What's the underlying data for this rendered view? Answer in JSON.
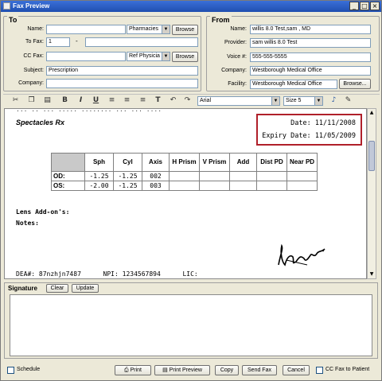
{
  "window": {
    "title": "Fax Preview",
    "minimize": "_",
    "maximize": "□",
    "close": "×"
  },
  "to": {
    "group_title": "To",
    "name_label": "Name:",
    "name_value": "",
    "name_type": "Pharmacies",
    "browse": "Browse",
    "tofax_label": "To Fax:",
    "tofax_area": "1",
    "tofax_dash": "-",
    "tofax_number": "",
    "ccfax_label": "CC Fax:",
    "ccfax_value": "",
    "ccfax_type": "Ref Physicia",
    "browse2": "Browse",
    "subject_label": "Subject:",
    "subject_value": "Prescription",
    "company_label": "Company:",
    "company_value": ""
  },
  "from": {
    "group_title": "From",
    "name_label": "Name:",
    "name_value": "willis 8.0 Test,sam , MD",
    "provider_label": "Provider:",
    "provider_value": "sam willis 8.0 Test",
    "voice_label": "Voice #:",
    "voice_value": "555-555-5555",
    "company_label": "Company:",
    "company_value": "Westborough Medical Office",
    "facility_label": "Facility:",
    "facility_value": "Westborough Medical Office",
    "browse": "Browse..."
  },
  "toolbar": {
    "font": "Arial",
    "size": "Size 5",
    "icons": [
      "cut-icon",
      "copy-icon",
      "paste-icon",
      "bold-icon",
      "italic-icon",
      "underline-icon",
      "align-left-icon",
      "align-center-icon",
      "align-right-icon",
      "format-icon",
      "undo-icon",
      "redo-icon"
    ]
  },
  "document": {
    "cut_line": "... .. ... ..... ........ ... ... ....",
    "heading": "Spectacles Rx",
    "date_label": "Date:",
    "date_value": "11/11/2008",
    "expiry_label": "Expiry Date:",
    "expiry_value": "11/05/2009",
    "table": {
      "headers": [
        "Sph",
        "Cyl",
        "Axis",
        "H Prism",
        "V Prism",
        "Add",
        "Dist PD",
        "Near PD"
      ],
      "rows": [
        {
          "label": "OD:",
          "cells": [
            "-1.25",
            "-1.25",
            "002",
            "",
            "",
            "",
            "",
            ""
          ]
        },
        {
          "label": "OS:",
          "cells": [
            "-2.00",
            "-1.25",
            "003",
            "",
            "",
            "",
            "",
            ""
          ]
        }
      ]
    },
    "lens_addons": "Lens Add-on's:",
    "notes": "Notes:",
    "dea": "DEA#: 87nzhjn7487",
    "npi": "NPI: 1234567894",
    "lic": "LIC:"
  },
  "signature": {
    "label": "Signature",
    "clear": "Clear",
    "update": "Update"
  },
  "bottom": {
    "schedule": "Schedule",
    "print": "Print",
    "print_preview": "Print Preview",
    "copy": "Copy",
    "send_fax": "Send Fax",
    "cancel": "Cancel",
    "cc_patient": "CC Fax to Patient"
  }
}
